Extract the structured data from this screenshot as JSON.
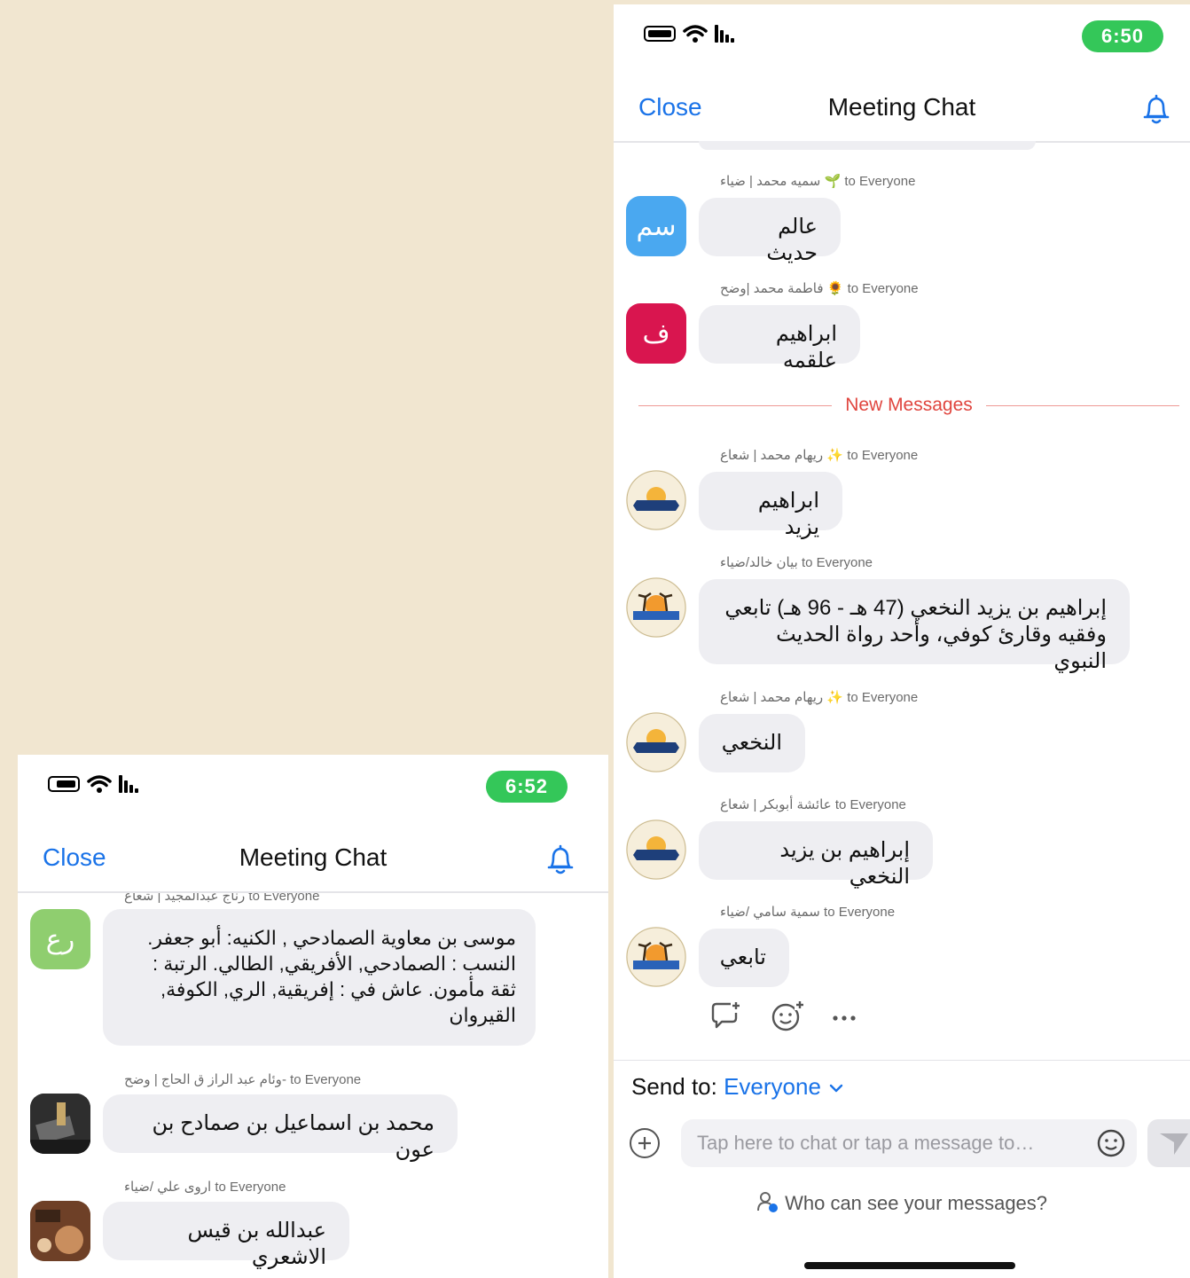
{
  "right": {
    "status": {
      "time": "6:50"
    },
    "nav": {
      "close": "Close",
      "title": "Meeting Chat"
    },
    "messages": [
      {
        "sender": "سميه محمد | ضياء 🌱 to Everyone",
        "text": "عالم حديث",
        "avatar_text": "سم",
        "avatar_color": "#4aa8f0"
      },
      {
        "sender": "فاطمة محمد |وضح 🌻 to Everyone",
        "text": "ابراهيم علقمه",
        "avatar_text": "ف",
        "avatar_color": "#d9154f"
      },
      {
        "sender": "ريهام محمد | شعاع ✨ to Everyone",
        "text": "ابراهيم يزيد",
        "avatar_icon": "shuaa-logo"
      },
      {
        "sender": "بيان خالد/ضياء to Everyone",
        "text_lines": [
          "إبراهيم بن يزيد النخعي (47 هـ - 96 هـ) تابعي",
          "وفقيه وقارئ كوفي، وأحد رواة الحديث النبوي"
        ],
        "avatar_icon": "diyaa-logo"
      },
      {
        "sender": "ريهام محمد | شعاع ✨ to Everyone",
        "text": "النخعي",
        "avatar_icon": "shuaa-logo"
      },
      {
        "sender": "عائشة أبوبكر | شعاع to Everyone",
        "text": "إبراهيم بن يزيد النخعي",
        "avatar_icon": "shuaa-logo"
      },
      {
        "sender": "سمية سامي /ضياء to Everyone",
        "text": "تابعي",
        "avatar_icon": "diyaa-logo"
      }
    ],
    "new_messages_label": "New Messages",
    "send_to_label": "Send to:",
    "send_to_value": "Everyone",
    "input_placeholder": "Tap here to chat or tap a message to…",
    "who_can_see": "Who can see your messages?"
  },
  "left": {
    "status": {
      "time": "6:52"
    },
    "nav": {
      "close": "Close",
      "title": "Meeting Chat"
    },
    "partial_sender": "رناج عبدالمجيد | شعاع to Everyone",
    "messages": [
      {
        "text_lines": [
          "موسى بن معاوية الصمادحي , الكنيه: أبو جعفر.",
          "النسب : الصمادحي, الأفريقي, الطالي. الرتبة :",
          "ثقة مأمون. عاش في : إفريقية, الري, الكوفة,",
          "القيروان"
        ],
        "avatar_text": "رع",
        "avatar_color": "#8fce6f"
      },
      {
        "sender": "وئام عبد الراز ق الحاج | وضح- to Everyone",
        "text": "محمد بن اسماعيل بن صمادح بن عون",
        "avatar_icon": "photo-avatar"
      },
      {
        "sender": "اروى علي /ضياء to Everyone",
        "text": "عبدالله بن قيس الاشعري",
        "avatar_icon": "photo-avatar"
      }
    ]
  },
  "colors": {
    "accent": "#1a73e8",
    "time_pill": "#34c759",
    "new_messages": "#e0463f"
  }
}
